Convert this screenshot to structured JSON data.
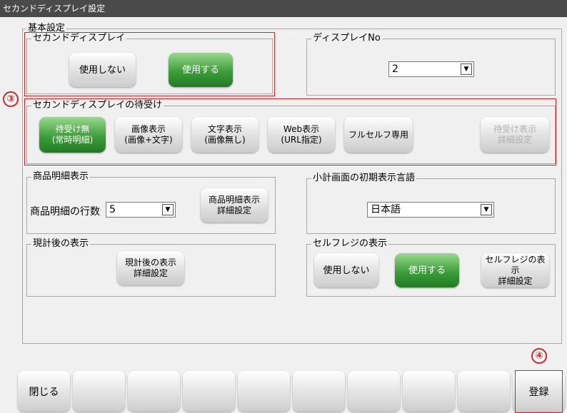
{
  "window": {
    "title": "セカンドディスプレイ設定"
  },
  "basic_settings": {
    "label": "基本設定"
  },
  "second_display": {
    "label": "セカンドディスプレイ",
    "not_use_label": "使用しない",
    "use_label": "使用する",
    "selected": "使用する"
  },
  "display_no": {
    "label": "ディスプレイNo",
    "value": "2"
  },
  "standby": {
    "label": "セカンドディスプレイの待受け",
    "buttons": [
      {
        "line1": "待受け無",
        "line2": "(常時明細)"
      },
      {
        "line1": "画像表示",
        "line2": "(画像+文字)"
      },
      {
        "line1": "文字表示",
        "line2": "(画像無し)"
      },
      {
        "line1": "Web表示",
        "line2": "(URL指定)"
      },
      {
        "line1": "フルセルフ専用",
        "line2": ""
      },
      {
        "line1": "待受け表示",
        "line2": "詳細設定"
      }
    ],
    "selected": "待受け無"
  },
  "item_detail": {
    "label": "商品明細表示",
    "rows_label": "商品明細の行数",
    "rows_value": "5",
    "detail_btn_line1": "商品明細表示",
    "detail_btn_line2": "詳細設定"
  },
  "subtotal_language": {
    "label": "小計画面の初期表示言語",
    "value": "日本語"
  },
  "after_settlement": {
    "label": "現計後の表示",
    "detail_btn_line1": "現計後の表示",
    "detail_btn_line2": "詳細設定"
  },
  "self_register": {
    "label": "セルフレジの表示",
    "not_use_label": "使用しない",
    "use_label": "使用する",
    "detail_btn_line1": "セルフレジの表示",
    "detail_btn_line2": "詳細設定",
    "selected": "使用する"
  },
  "footer": {
    "close_label": "閉じる",
    "register_label": "登録"
  },
  "annotations": {
    "marker3": "③",
    "marker4": "④",
    "color": "#e02020"
  }
}
